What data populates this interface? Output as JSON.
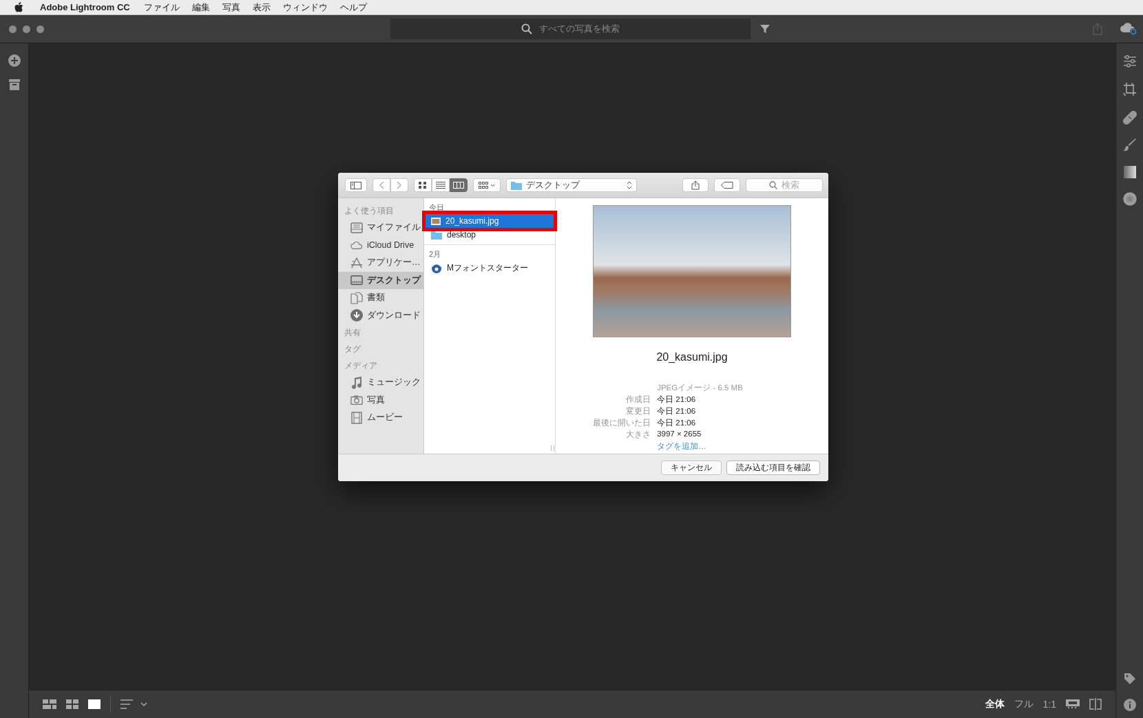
{
  "menubar": {
    "app": "Adobe Lightroom CC",
    "items": [
      "ファイル",
      "編集",
      "写真",
      "表示",
      "ウィンドウ",
      "ヘルプ"
    ]
  },
  "toolbar": {
    "search": {
      "placeholder": "すべての写真を検索"
    }
  },
  "dialog": {
    "view_modes": [
      {
        "kind": "icons",
        "selected": false
      },
      {
        "kind": "list",
        "selected": false
      },
      {
        "kind": "columns",
        "selected": true
      }
    ],
    "location": "デスクトップ",
    "search": {
      "placeholder": "検索"
    },
    "sidebar": [
      {
        "heading": "よく使う項目",
        "items": [
          {
            "label": "マイファイル",
            "kind": "files",
            "selected": false
          },
          {
            "label": "iCloud Drive",
            "kind": "cloud",
            "selected": false
          },
          {
            "label": "アプリケー…",
            "kind": "apps",
            "selected": false
          },
          {
            "label": "デスクトップ",
            "kind": "desktop",
            "selected": true
          },
          {
            "label": "書類",
            "kind": "documents",
            "selected": false
          },
          {
            "label": "ダウンロード",
            "kind": "download",
            "selected": false
          }
        ]
      },
      {
        "heading": "共有"
      },
      {
        "heading": "タグ"
      },
      {
        "heading": "メディア",
        "items": [
          {
            "label": "ミュージック",
            "kind": "music",
            "selected": false
          },
          {
            "label": "写真",
            "kind": "photos",
            "selected": false
          },
          {
            "label": "ムービー",
            "kind": "movies",
            "selected": false
          }
        ]
      }
    ],
    "column": [
      {
        "heading": "今日",
        "items": [
          {
            "name": "20_kasumi.jpg",
            "kind": "image",
            "selected": true,
            "highlighted": true
          },
          {
            "name": "desktop",
            "kind": "folder",
            "selected": false,
            "highlighted": false
          }
        ]
      },
      {
        "heading": "2月",
        "items": [
          {
            "name": "Mフォントスターター",
            "kind": "app",
            "selected": false,
            "highlighted": false
          }
        ]
      }
    ],
    "preview": {
      "name": "20_kasumi.jpg",
      "type": "JPEGイメージ - 6.5 MB",
      "details": [
        {
          "label": "作成日",
          "value": "今日 21:06"
        },
        {
          "label": "変更日",
          "value": "今日 21:06"
        },
        {
          "label": "最後に開いた日",
          "value": "今日 21:06"
        },
        {
          "label": "大きさ",
          "value": "3997 × 2655"
        }
      ],
      "add_tag": "タグを追加…"
    },
    "buttons": [
      {
        "label": "キャンセル",
        "kind": "cancel"
      },
      {
        "label": "読み込む項目を確認",
        "kind": "default"
      }
    ]
  },
  "bottom_bar": {
    "zoom": [
      {
        "label": "全体",
        "selected": true
      },
      {
        "label": "フル",
        "selected": false
      },
      {
        "label": "1:1",
        "selected": false
      }
    ]
  }
}
